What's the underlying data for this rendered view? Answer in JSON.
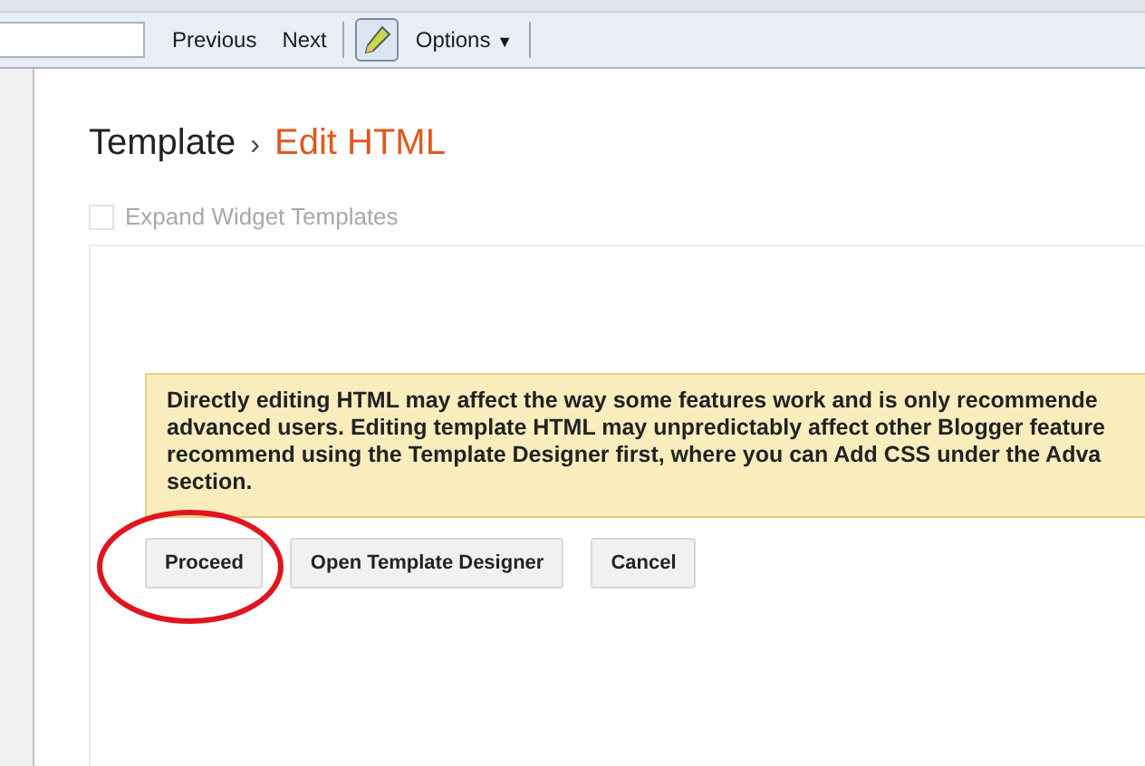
{
  "toolbar": {
    "buttons": [
      {
        "kind": "text",
        "label": "Previous"
      },
      {
        "kind": "text",
        "label": "Next"
      },
      {
        "kind": "icon"
      },
      {
        "kind": "menu",
        "label": "Options",
        "caret": "▼"
      }
    ]
  },
  "breadcrumb": {
    "parent": "Template",
    "separator": "›",
    "current": "Edit HTML"
  },
  "expand_widgets": {
    "label": "Expand Widget Templates",
    "checked": false,
    "disabled": true
  },
  "warning": {
    "lines": [
      "Directly editing HTML may affect the way some features work and is only recommende",
      "advanced users. Editing template HTML may unpredictably affect other Blogger feature",
      "recommend using the Template Designer first, where you can Add CSS under the Adva",
      "section."
    ]
  },
  "actions": [
    {
      "label": "Proceed",
      "circled": true
    },
    {
      "label": "Open Template Designer",
      "circled": false
    },
    {
      "label": "Cancel",
      "circled": false
    }
  ]
}
